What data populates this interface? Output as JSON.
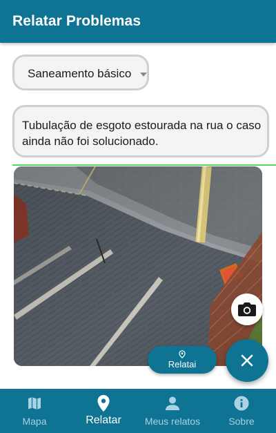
{
  "appbar": {
    "title": "Relatar Problemas"
  },
  "form": {
    "category": {
      "selected": "Saneamento básico"
    },
    "description": {
      "value": "Tubulação de esgoto estourada na rua o caso ainda não foi solucionado."
    }
  },
  "actions": {
    "camera_icon": "camera-icon",
    "relatai_label": "Relatai",
    "close_icon": "close-icon"
  },
  "bottom_nav": {
    "items": [
      {
        "label": "Mapa",
        "icon": "map-icon",
        "active": false
      },
      {
        "label": "Relatar",
        "icon": "location-pin-icon",
        "active": true
      },
      {
        "label": "Meus relatos",
        "icon": "person-icon",
        "active": false
      },
      {
        "label": "Sobre",
        "icon": "info-icon",
        "active": false
      }
    ]
  },
  "colors": {
    "primary": "#0f7393",
    "accent_line": "#4cd964",
    "field_background": "#f3f5f5",
    "field_border": "#cfcfcf"
  }
}
